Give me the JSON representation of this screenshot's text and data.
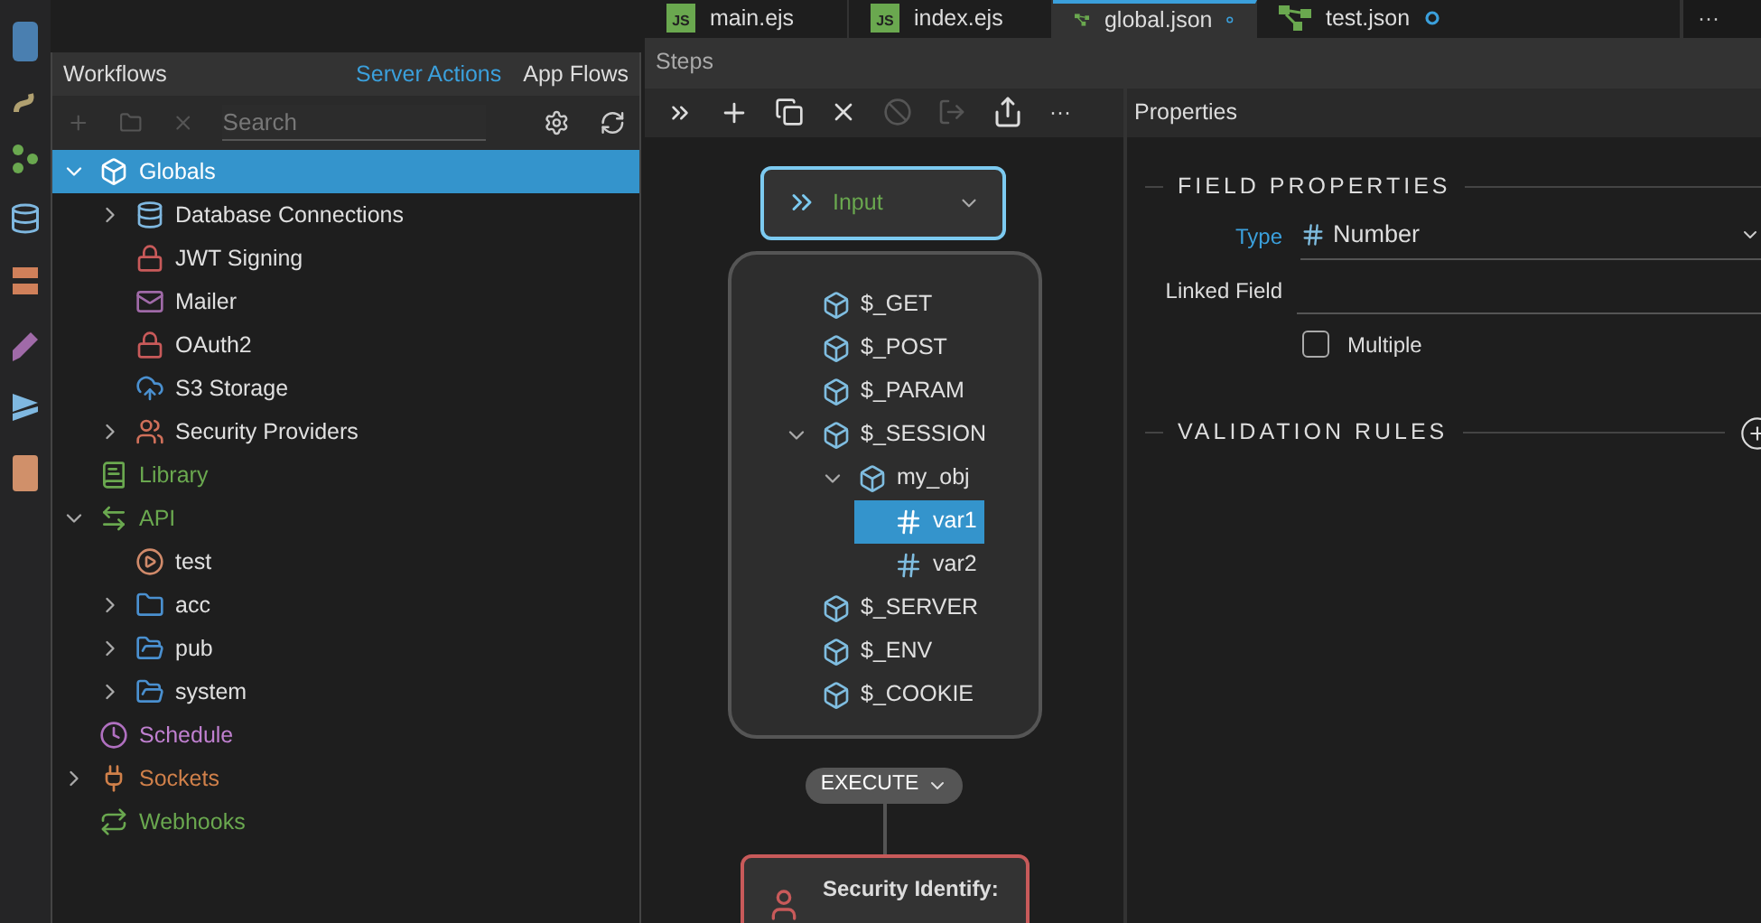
{
  "tabs": [
    {
      "label": "main.ejs",
      "kind": "js",
      "badge": "JS",
      "selected": false,
      "modified": false
    },
    {
      "label": "index.ejs",
      "kind": "js",
      "badge": "JS",
      "selected": false,
      "modified": false
    },
    {
      "label": "global.json",
      "kind": "flow",
      "selected": true,
      "modified": true
    },
    {
      "label": "test.json",
      "kind": "flow",
      "selected": false,
      "modified": true
    }
  ],
  "tabs_more": "···",
  "workflows": {
    "title": "Workflows",
    "links": [
      {
        "label": "Server Actions",
        "selected": true
      },
      {
        "label": "App Flows",
        "selected": false
      }
    ],
    "search": {
      "placeholder": "Search"
    },
    "tree": [
      {
        "label": "Globals",
        "kind": "globals",
        "expanded": true,
        "selected": true,
        "children": [
          {
            "label": "Database Connections",
            "kind": "database",
            "expanded": false,
            "selected": false
          },
          {
            "label": "JWT Signing",
            "kind": "lock",
            "selected": false
          },
          {
            "label": "Mailer",
            "kind": "mail",
            "selected": false
          },
          {
            "label": "OAuth2",
            "kind": "lock",
            "selected": false
          },
          {
            "label": "S3 Storage",
            "kind": "cloud",
            "selected": false
          },
          {
            "label": "Security Providers",
            "kind": "users",
            "expanded": false,
            "selected": false
          }
        ]
      },
      {
        "label": "Library",
        "kind": "library",
        "selected": false
      },
      {
        "label": "API",
        "kind": "api",
        "expanded": true,
        "selected": false,
        "children": [
          {
            "label": "test",
            "kind": "action",
            "selected": false
          },
          {
            "label": "acc",
            "kind": "folder",
            "expanded": false,
            "selected": false
          },
          {
            "label": "pub",
            "kind": "folder-open",
            "expanded": false,
            "selected": false
          },
          {
            "label": "system",
            "kind": "folder-open",
            "expanded": false,
            "selected": false
          }
        ]
      },
      {
        "label": "Schedule",
        "kind": "schedule",
        "selected": false
      },
      {
        "label": "Sockets",
        "kind": "sockets",
        "expanded": false,
        "selected": false
      },
      {
        "label": "Webhooks",
        "kind": "webhooks",
        "selected": false
      }
    ]
  },
  "steps": {
    "title": "Steps",
    "toolbar_more": "···",
    "input_node": {
      "label": "Input"
    },
    "input_tree": [
      {
        "label": "$_GET",
        "kind": "object",
        "selected": false
      },
      {
        "label": "$_POST",
        "kind": "object",
        "selected": false
      },
      {
        "label": "$_PARAM",
        "kind": "object",
        "selected": false
      },
      {
        "label": "$_SESSION",
        "kind": "object",
        "expanded": true,
        "selected": false,
        "children": [
          {
            "label": "my_obj",
            "kind": "object",
            "expanded": true,
            "selected": false,
            "children": [
              {
                "label": "var1",
                "kind": "number",
                "selected": true
              },
              {
                "label": "var2",
                "kind": "number",
                "selected": false
              }
            ]
          }
        ]
      },
      {
        "label": "$_SERVER",
        "kind": "object",
        "selected": false
      },
      {
        "label": "$_ENV",
        "kind": "object",
        "selected": false
      },
      {
        "label": "$_COOKIE",
        "kind": "object",
        "selected": false
      }
    ],
    "execute": {
      "label": "EXECUTE"
    },
    "step_node": {
      "label": "Security Identify:"
    }
  },
  "properties": {
    "title": "Properties",
    "sections": [
      {
        "title": "FIELD PROPERTIES",
        "kind": "fields"
      },
      {
        "title": "VALIDATION RULES",
        "kind": "rules"
      }
    ],
    "type": {
      "label": "Type",
      "value": "Number"
    },
    "linked_field": {
      "label": "Linked Field"
    },
    "multiple": {
      "label": "Multiple",
      "checked": false
    }
  }
}
